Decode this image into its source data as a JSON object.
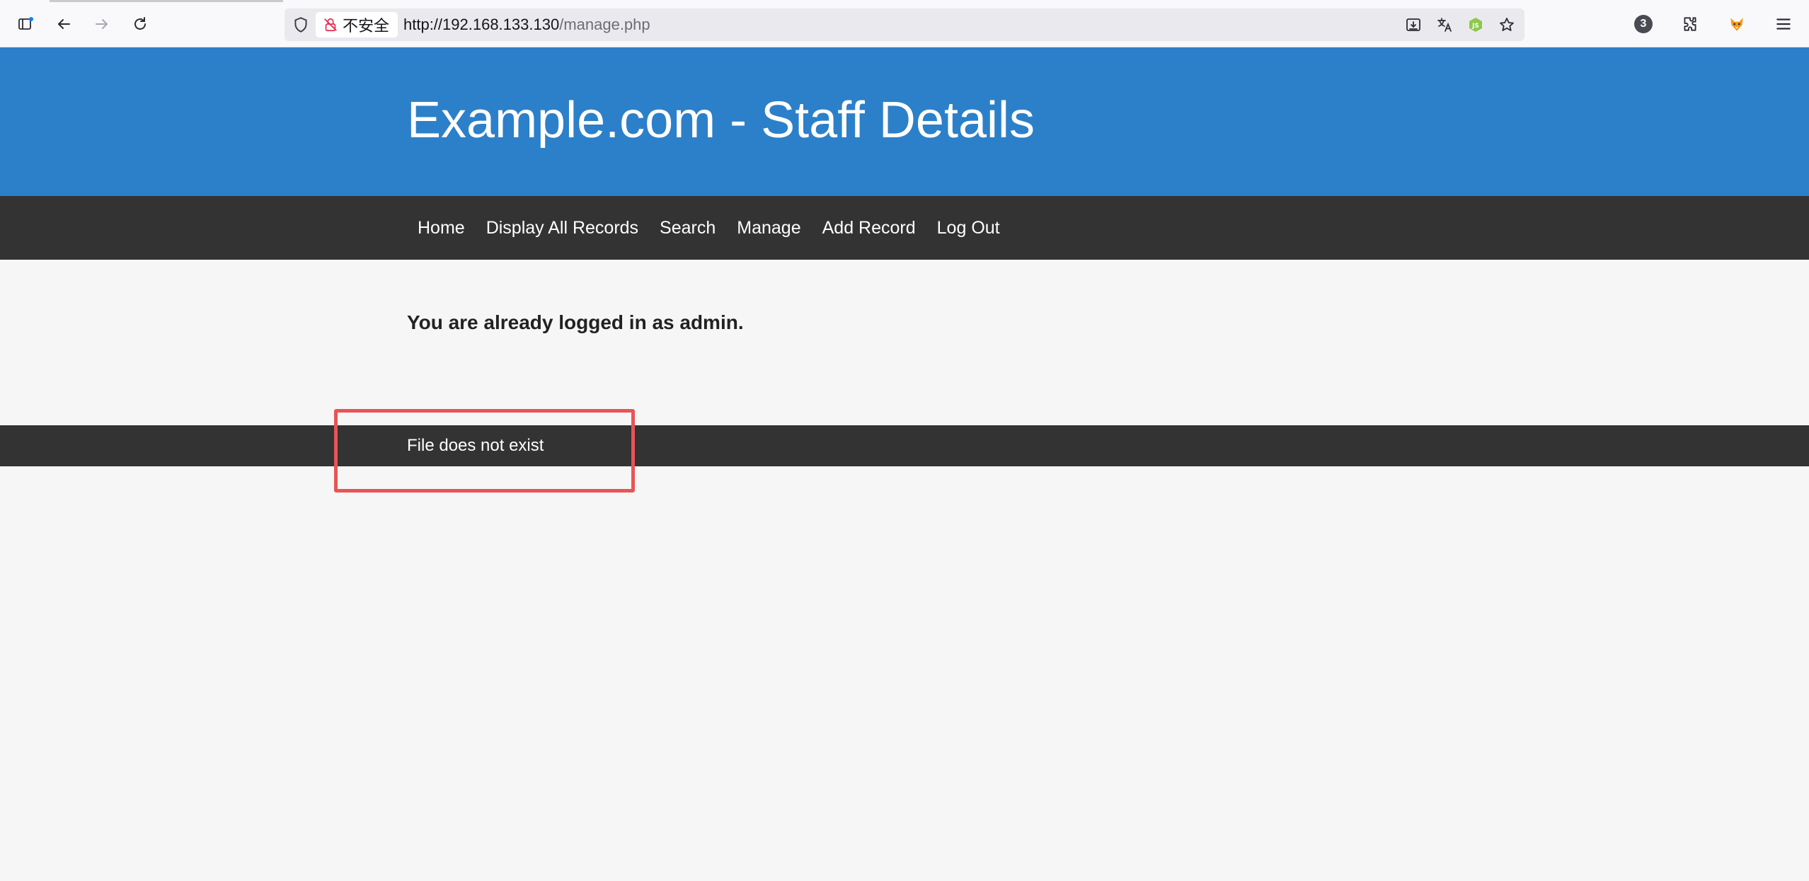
{
  "browser": {
    "security_label": "不安全",
    "url_domain": "http://192.168.133.130",
    "url_path": "/manage.php",
    "extensions_count": "3",
    "icons": {
      "sidebar": "sidebar-icon",
      "back": "back-arrow-icon",
      "forward": "forward-arrow-icon",
      "reload": "reload-icon",
      "shield": "shield-icon",
      "insecure_lock": "insecure-lock-icon",
      "download": "save-to-page-icon",
      "translate": "translate-icon",
      "node_ext": "nodejs-extension-icon",
      "bookmark": "bookmark-star-icon",
      "extensions": "extensions-puzzle-icon",
      "fox_ext": "fox-extension-icon",
      "menu": "hamburger-menu-icon"
    }
  },
  "header": {
    "title": "Example.com - Staff Details",
    "color": "#2c80c9"
  },
  "nav": {
    "items": [
      {
        "label": "Home"
      },
      {
        "label": "Display All Records"
      },
      {
        "label": "Search"
      },
      {
        "label": "Manage"
      },
      {
        "label": "Add Record"
      },
      {
        "label": "Log Out"
      }
    ]
  },
  "main": {
    "message": "You are already logged in as admin."
  },
  "footer": {
    "text": "File does not exist"
  },
  "annotation": {
    "highlight_color": "#e85456"
  }
}
